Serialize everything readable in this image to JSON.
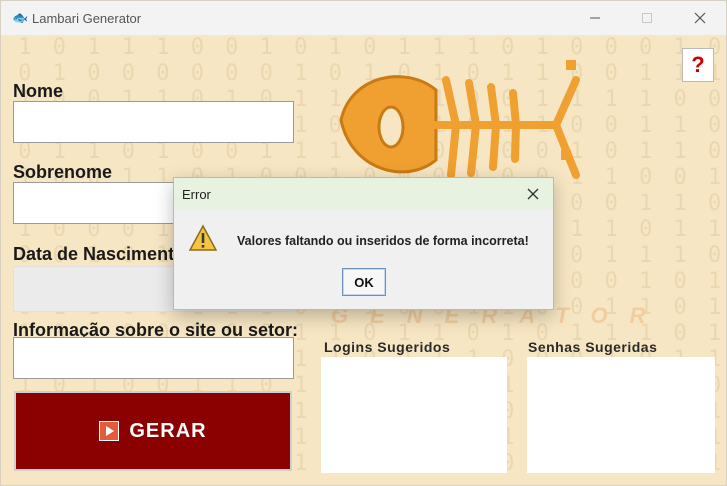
{
  "window": {
    "title": "Lambari Generator",
    "minimize_icon": "minimize-icon",
    "maximize_icon": "maximize-icon",
    "close_icon": "close-icon"
  },
  "background": {
    "rows": [
      "1 0 1 1 1 0 0 1 0 1 0 1 1 1 0 1 0 0 0 1 0 1 1",
      "0 1 0 0 0 0 0 0 1 0 1 0 1 0 1 1 0 0 1 1 1 1 0",
      "1 0 0 1 1 0 1 0 1 1 0 0 1 0 0 1 1 1 1 0 0 1 0",
      "1 0 0 0 1 0 1 1 1 0 0 0 1 0 1 1 0 0 1 1 0 0 1",
      "0 1 1 0 1 0 0 1 1 1 1 1 0 1 0 0 1 0 1 1 0 0 1",
      "1 0 0 1 1 0 1 0 0 1 0 0 0 0 0 0 1 1 0 0 1 1 1",
      "0 1 1 0 0 0 0 0 1 0 1 0 1 0 1 1 0 0 1 1 0 0 0",
      "1 0 0 0 1 0 1 0 1 1 0 0 1 1 0 1 1 1 0 1 1 0 1",
      "0 0 1 0 1 0 1 0 0 1 0 1 1 0 1 1 0 1 1 1 0 1 0",
      "1 1 1 0 1 0 0 1 0 0 1 1 1 0 0 1 0 0 1 0 1 0 0",
      "0 1 1 0 0 1 1 1 0 1 1 0 0 1 1 0 0 1 1 0 1 1 0",
      "1 0 1 0 0 0 0 0 1 1 0 1 1 0 1 0 1 1 1 0 1 0 1",
      "0 1 1 0 1 0 0 0 1 1 0 0 1 1 0 0 0 1 0 1 1 0 0",
      "1 0 1 0 0 1 1 0 1 1 1 1 0 0 1 0 0 1 0 1 0 0 1",
      "0 1 0 1 1 1 0 0 1 0 0 0 1 1 0 0 1 0 1 1 1 0 1",
      "1 1 0 0 0 0 0 1 1 0 1 0 1 1 1 0 0 1 1 0 1 0 1",
      "0 1 0 1 0 0 1 1 1 1 0 0 1 1 0 0 1 0 1 1 1 0 0"
    ],
    "logo_word": "GENERATOR"
  },
  "form": {
    "nome_label": "Nome",
    "nome_value": "",
    "sobrenome_label": "Sobrenome",
    "sobrenome_value": "",
    "data_label": "Data de Nascimento",
    "data_value": "",
    "info_label": "Informação sobre o site ou setor:",
    "info_value": ""
  },
  "gerar_button": {
    "label": "GERAR",
    "icon": "play-icon"
  },
  "help_button": {
    "label": "?"
  },
  "lists": {
    "logins_title": "Logins Sugeridos",
    "senhas_title": "Senhas Sugeridas"
  },
  "dialog": {
    "title": "Error",
    "message": "Valores faltando ou inseridos de forma incorreta!",
    "ok_label": "OK",
    "icon": "warning-icon"
  },
  "colors": {
    "background": "#f7e6c3",
    "gerar_button": "#8b0000",
    "help_mark": "#d00000",
    "fish": "#f0a030"
  }
}
